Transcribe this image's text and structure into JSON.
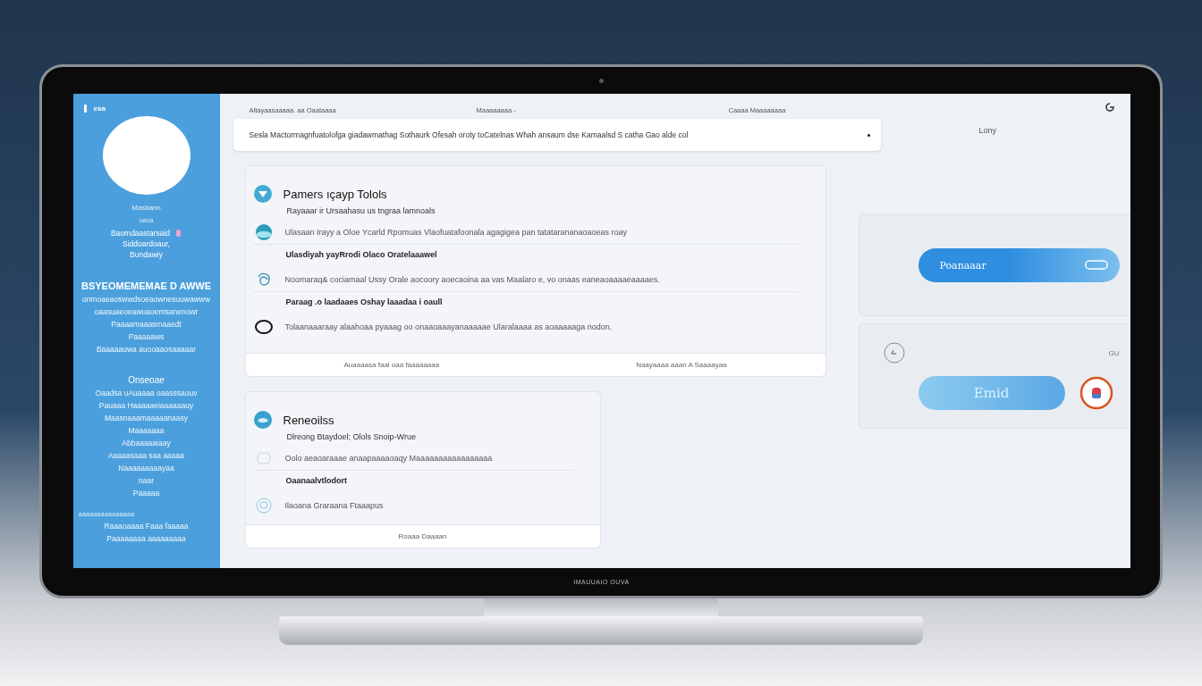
{
  "sidebar": {
    "top_label": "esa",
    "name": "Mastiann",
    "role": "uaoa",
    "details": [
      "Baomdaastarsaid",
      "Siddoardoaur,",
      "Bundawiy"
    ],
    "groups": [
      {
        "heading": "BSYEOMEMEMAE D AWWE",
        "lines": [
          "onmoaeaoswwdsoeaownesuuwawww",
          "oaasuaeoeawuaoemsanenowr",
          "Paaaamaaasmaaedt",
          "Paaaaaws",
          "Baaaaauwa auooaaosaaaaar"
        ]
      },
      {
        "heading": "Onseoae",
        "lines": [
          "Oaadsa uAuaaaa oaasssaouv",
          "Pauaaa Haaaaaeiaaaaaauy",
          "Maasnaaamaaaaanaasy",
          "Maaaaaaa",
          "Abbaaaaaiaay",
          "Aaaaasaaa saa aaaaa",
          "Naaaaaaaaayaa",
          "naar",
          "Paaaaa"
        ]
      },
      {
        "heading": "aaaaaaaaaaaaaaa",
        "lines": [
          "Raaaoaaaa Faaa faaaaa",
          "Paaaaaaaa aaaaaaaaa"
        ]
      }
    ]
  },
  "header": {
    "columns": [
      "Altayaasaaaaa. aa Oaataaaa",
      "Maaaaaaaa -",
      "Caaaa  Maaaaaaaa"
    ],
    "search": {
      "value": "Sesla Mactormagnfuatolofga giadawmathag Sothaurk Ofesah oroty toCatelnas  Whah ansaum dse Kamaalsd S catha Gao alde col"
    },
    "right_label": "Lony"
  },
  "cards": [
    {
      "title": "Pamers ıçayp Tolols",
      "subtitle": "Rayaaar ir Ursaahasu us tngraa lamnoals",
      "items": [
        {
          "kind": "entry",
          "text": "Ulasaan Irayy a Oloe Ycarld Rpomuas Vlaofuatafoonala agagigea pan tatatarananaoaoeas roay"
        },
        {
          "kind": "heading",
          "text": "Ulasdiyah yayRrodi Olaco Oratelaaawel"
        },
        {
          "kind": "entry",
          "text": "Noomaraq& cociamaal Ussy Orale aocoory aoecaoina aa vas Maalaro e, vo onaas eaneaoaaaaeaaaaes."
        },
        {
          "kind": "heading",
          "text": "Paraag .o laadaaes  Oshay laaadaa i oaull"
        },
        {
          "kind": "entry",
          "text": "Tolaanaaaraay alaahoaa pyaaag oo onaaoaaayanaaaaae  Ularalaaaa as aoaaaaaga nodon."
        }
      ],
      "footer": [
        "Auaaaasa faal oaa faaaaaaaa",
        "Naayaaaa aaan  A Saaaayaa"
      ]
    },
    {
      "title": "Reneoilss",
      "subtitle": "Dlreong Btaydoel; Olols Snoip-Wrue",
      "items": [
        {
          "kind": "entry",
          "text": "Oolo aeaoaraaae anaapaaaaoaqy Maaaaaaaaaaaaaaaaa"
        },
        {
          "kind": "heading",
          "text": "Oaanaalvtlodort"
        },
        {
          "kind": "entry",
          "text": "Ilaoana Graraana Ftaaapus"
        }
      ],
      "footer": [
        "Roaaa Daaaan"
      ]
    }
  ],
  "right_panels": [
    {
      "button": "Poanaaar"
    },
    {
      "corner_label": "GU",
      "button": "Emid"
    }
  ],
  "monitor": {
    "brand": "IMAUUAIO OUVA"
  }
}
